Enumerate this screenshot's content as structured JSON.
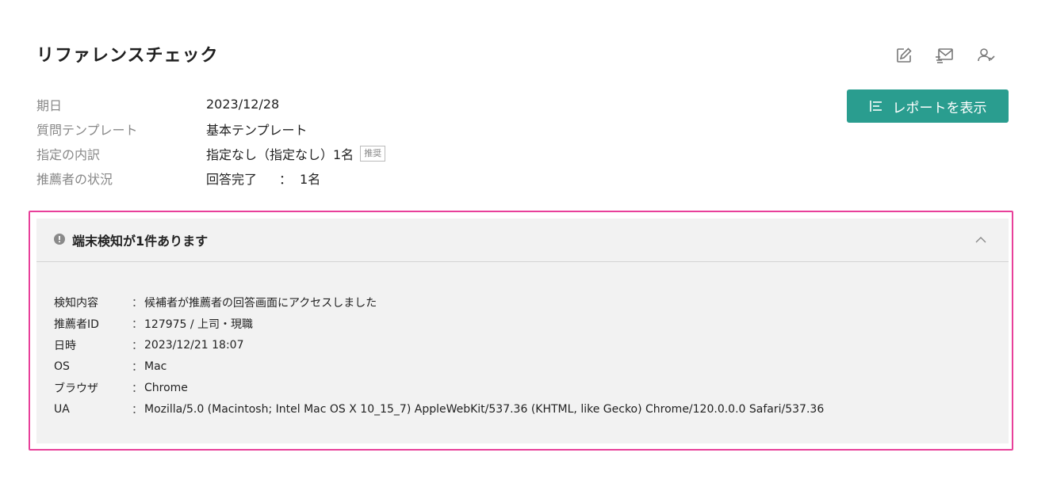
{
  "header": {
    "title": "リファレンスチェック",
    "icons": [
      "edit-icon",
      "mail-icon",
      "user-check-icon"
    ],
    "report_button_label": "レポートを表示"
  },
  "meta": {
    "rows": [
      {
        "label": "期日",
        "value": "2023/12/28"
      },
      {
        "label": "質問テンプレート",
        "value": "基本テンプレート"
      },
      {
        "label": "指定の内訳",
        "value": "指定なし（指定なし）1名",
        "tag": "推奨"
      },
      {
        "label": "推薦者の状況",
        "value": "回答完了",
        "colon": "：",
        "count": "1名"
      }
    ]
  },
  "alert_panel": {
    "title": "端末検知が1件あります",
    "expanded": true,
    "details": [
      {
        "label": "検知内容",
        "colon": "：",
        "value": "候補者が推薦者の回答画面にアクセスしました"
      },
      {
        "label": "推薦者ID",
        "colon": "：",
        "value": "127975 / 上司・現職"
      },
      {
        "label": "日時",
        "colon": "：",
        "value": "2023/12/21 18:07"
      },
      {
        "label": "OS",
        "colon": "：",
        "value": "Mac"
      },
      {
        "label": "ブラウザ",
        "colon": "：",
        "value": "Chrome"
      },
      {
        "label": "UA",
        "colon": "：",
        "value": "Mozilla/5.0 (Macintosh; Intel Mac OS X 10_15_7) AppleWebKit/537.36 (KHTML, like Gecko) Chrome/120.0.0.0 Safari/537.36"
      }
    ]
  },
  "colors": {
    "accent": "#2a9d8f",
    "highlight": "#e8409a",
    "panel_bg": "#f2f2f2"
  }
}
